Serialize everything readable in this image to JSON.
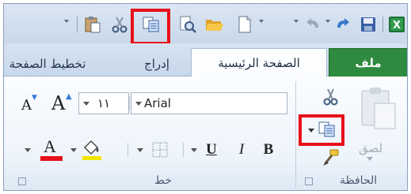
{
  "tabs": [
    {
      "label": "ملف"
    },
    {
      "label": "الصفحة الرئيسية"
    },
    {
      "label": "إدراج"
    },
    {
      "label": "تخطيط الصفحة"
    }
  ],
  "font": {
    "name": "Arial",
    "size": "١١",
    "bold_label": "B",
    "italic_label": "I",
    "underline_label": "U",
    "font_color_label": "A",
    "grow_font_label": "A",
    "shrink_font_label": "A",
    "group_label": "خط"
  },
  "clipboard": {
    "paste_label": "لصق",
    "group_label": "الحافظة"
  },
  "colors": {
    "file_tab": "#2d8a3e",
    "highlight": "#e8101a",
    "font_color_bar": "#e8101a",
    "highlight_color_bar": "#f2e600"
  },
  "icons": [
    "excel-icon",
    "save-icon",
    "redo-icon",
    "undo-icon",
    "new-icon",
    "open-icon",
    "print-preview-icon",
    "copy-icon",
    "cut-icon",
    "paste-icon",
    "format-painter-icon",
    "borders-icon",
    "fill-color-icon"
  ]
}
